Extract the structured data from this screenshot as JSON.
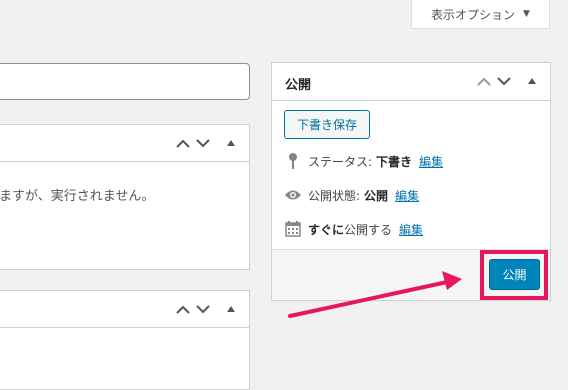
{
  "screen_options": {
    "label": "表示オプション",
    "toggle_icon": "triangle-down-icon"
  },
  "left_box": {
    "description": "ますが、実行されません。"
  },
  "publish": {
    "title": "公開",
    "save_draft_label": "下書き保存",
    "status": {
      "label": "ステータス:",
      "value": "下書き",
      "edit": "編集"
    },
    "visibility": {
      "label": "公開状態:",
      "value": "公開",
      "edit": "編集"
    },
    "schedule": {
      "value": "すぐに",
      "label": "公開する",
      "edit": "編集"
    },
    "publish_button_label": "公開"
  },
  "colors": {
    "accent": "#0085ba",
    "link": "#0073aa",
    "highlight": "#e8175d"
  }
}
